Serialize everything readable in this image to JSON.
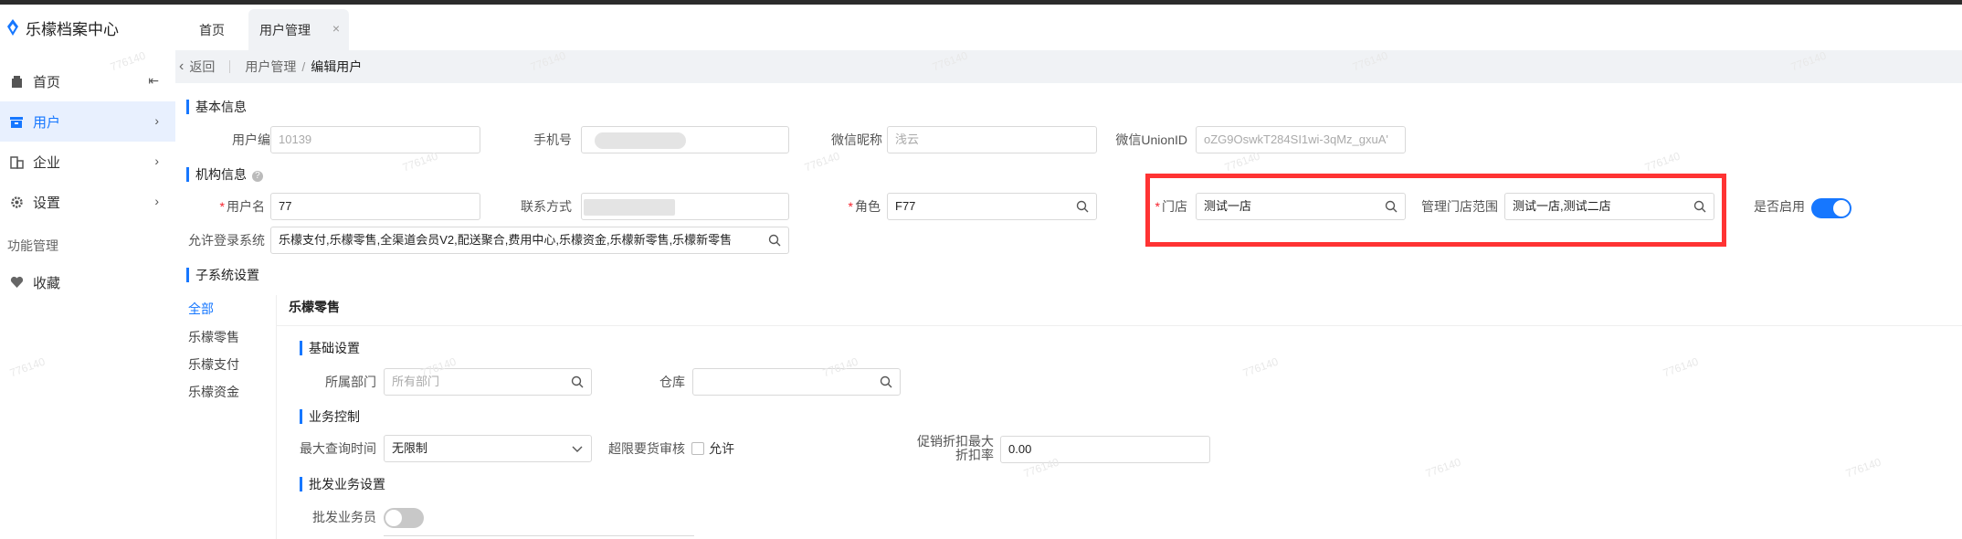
{
  "app": {
    "title": "乐檬档案中心"
  },
  "sidebar": {
    "items": [
      {
        "label": "首页",
        "icon": "home-icon"
      },
      {
        "label": "用户",
        "icon": "user-icon"
      },
      {
        "label": "企业",
        "icon": "building-icon"
      },
      {
        "label": "设置",
        "icon": "gear-icon"
      }
    ],
    "group_label": "功能管理",
    "favorites_label": "收藏"
  },
  "tabs": [
    {
      "label": "首页"
    },
    {
      "label": "用户管理"
    }
  ],
  "breadcrumb": {
    "back": "返回",
    "parent": "用户管理",
    "current": "编辑用户"
  },
  "basic": {
    "title": "基本信息",
    "user_no_label": "用户编号",
    "user_no_value": "10139",
    "phone_label": "手机号",
    "wechat_nick_label": "微信昵称",
    "wechat_nick_value": "浅云",
    "unionid_label": "微信UnionID",
    "unionid_value": "oZG9OswkT284SI1wi-3qMz_gxuA'"
  },
  "org": {
    "title": "机构信息",
    "username_label": "用户名",
    "username_value": "77",
    "contact_label": "联系方式",
    "role_label": "角色",
    "role_value": "F77",
    "store_label": "门店",
    "store_value": "测试一店",
    "scope_label": "管理门店范围",
    "scope_value": "测试一店,测试二店",
    "enabled_label": "是否启用",
    "enabled": true,
    "login_sys_label": "允许登录系统",
    "login_sys_value": "乐檬支付,乐檬零售,全渠道会员V2,配送聚合,费用中心,乐檬资金,乐檬新零售,乐檬新零售"
  },
  "subsystem": {
    "title": "子系统设置",
    "nav": [
      "全部",
      "乐檬零售",
      "乐檬支付",
      "乐檬资金"
    ],
    "panel_title": "乐檬零售",
    "basic_title": "基础设置",
    "dept_label": "所属部门",
    "dept_placeholder": "所有部门",
    "warehouse_label": "仓库",
    "biz_title": "业务控制",
    "max_query_label": "最大查询时间",
    "max_query_value": "无限制",
    "over_limit_label": "超限要货审核",
    "allow_label": "允许",
    "discount_label_1": "促销折扣最大",
    "discount_label_2": "折扣率",
    "discount_value": "0.00",
    "wholesale_title": "批发业务设置",
    "wholesale_clerk_label": "批发业务员",
    "wholesale_clerk_enabled": false
  },
  "watermark": "776140",
  "colors": {
    "accent": "#1677ff",
    "highlight": "#ff3333"
  }
}
